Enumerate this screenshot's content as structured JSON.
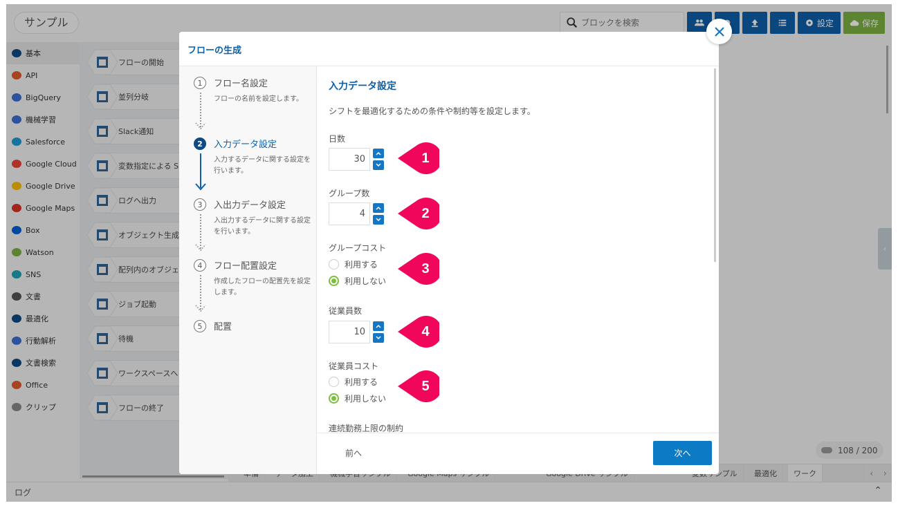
{
  "app": {
    "title": "サンプル",
    "search_placeholder": "ブロックを検索",
    "toolbar": {
      "users_icon": "users-icon",
      "settings_label": "設定",
      "save_label": "保存"
    }
  },
  "sidebar": {
    "items": [
      {
        "label": "基本",
        "icon": "cube-icon"
      },
      {
        "label": "API",
        "icon": "api-cloud-icon"
      },
      {
        "label": "BigQuery",
        "icon": "bigquery-icon"
      },
      {
        "label": "機械学習",
        "icon": "brain-icon"
      },
      {
        "label": "Salesforce",
        "icon": "salesforce-icon"
      },
      {
        "label": "Google Cloud",
        "icon": "google-cloud-icon"
      },
      {
        "label": "Google Drive",
        "icon": "google-drive-icon"
      },
      {
        "label": "Google Maps",
        "icon": "map-pin-icon"
      },
      {
        "label": "Box",
        "icon": "box-icon"
      },
      {
        "label": "Watson",
        "icon": "watson-icon"
      },
      {
        "label": "SNS",
        "icon": "chat-bubble-icon"
      },
      {
        "label": "文書",
        "icon": "document-icon"
      },
      {
        "label": "最適化",
        "icon": "atom-icon"
      },
      {
        "label": "行動解析",
        "icon": "behavior-icon"
      },
      {
        "label": "文書検索",
        "icon": "document-search-icon"
      },
      {
        "label": "Office",
        "icon": "office-icon"
      },
      {
        "label": "クリップ",
        "icon": "paperclip-icon"
      }
    ]
  },
  "blocks": [
    {
      "label": "フローの開始"
    },
    {
      "label": "並列分岐"
    },
    {
      "label": "Slack通知"
    },
    {
      "label": "変数指定による S"
    },
    {
      "label": "ログへ出力"
    },
    {
      "label": "オブジェクト生成"
    },
    {
      "label": "配列内のオブジェ 変換"
    },
    {
      "label": "ジョブ起動"
    },
    {
      "label": "待機"
    },
    {
      "label": "ワークスペースへ ジを送信"
    },
    {
      "label": "フローの終了"
    }
  ],
  "canvas": {
    "counter": "108 / 200",
    "tabs": [
      "準備",
      "データ加工",
      "機械学習サンプル",
      "Google Maps サンプル",
      "Google Drive サンプル",
      "変数サンプル",
      "最適化",
      "ワーク"
    ],
    "active_tab": "ワーク"
  },
  "log_bar": {
    "label": "ログ"
  },
  "modal": {
    "title": "フローの生成",
    "steps": [
      {
        "num": "1",
        "title": "フロー名設定",
        "desc": "フローの名前を設定します。"
      },
      {
        "num": "2",
        "title": "入力データ設定",
        "desc": "入力するデータに関する設定を行います。",
        "active": true
      },
      {
        "num": "3",
        "title": "入出力データ設定",
        "desc": "入出力するデータに関する設定を行います。"
      },
      {
        "num": "4",
        "title": "フロー配置設定",
        "desc": "作成したフローの配置先を設定します。"
      },
      {
        "num": "5",
        "title": "配置",
        "desc": ""
      }
    ],
    "section_title": "入力データ設定",
    "section_desc": "シフトを最適化するための条件や制約等を設定します。",
    "fields": {
      "days": {
        "label": "日数",
        "value": "30",
        "badge": "1"
      },
      "groups": {
        "label": "グループ数",
        "value": "4",
        "badge": "2"
      },
      "group_cost": {
        "label": "グループコスト",
        "options": [
          "利用する",
          "利用しない"
        ],
        "selected": "利用しない",
        "badge": "3"
      },
      "employees": {
        "label": "従業員数",
        "value": "10",
        "badge": "4"
      },
      "employee_cost": {
        "label": "従業員コスト",
        "options": [
          "利用する",
          "利用しない"
        ],
        "selected": "利用しない",
        "badge": "5"
      },
      "consecutive_limit": {
        "label": "連続勤務上限の制約"
      }
    },
    "prev_label": "前へ",
    "next_label": "次へ"
  },
  "colors": {
    "primary": "#0d5fa8",
    "button_blue": "#0d7ac6",
    "save_green": "#7db242",
    "badge_pink": "#f0065a",
    "radio_green": "#7cbf3e"
  }
}
